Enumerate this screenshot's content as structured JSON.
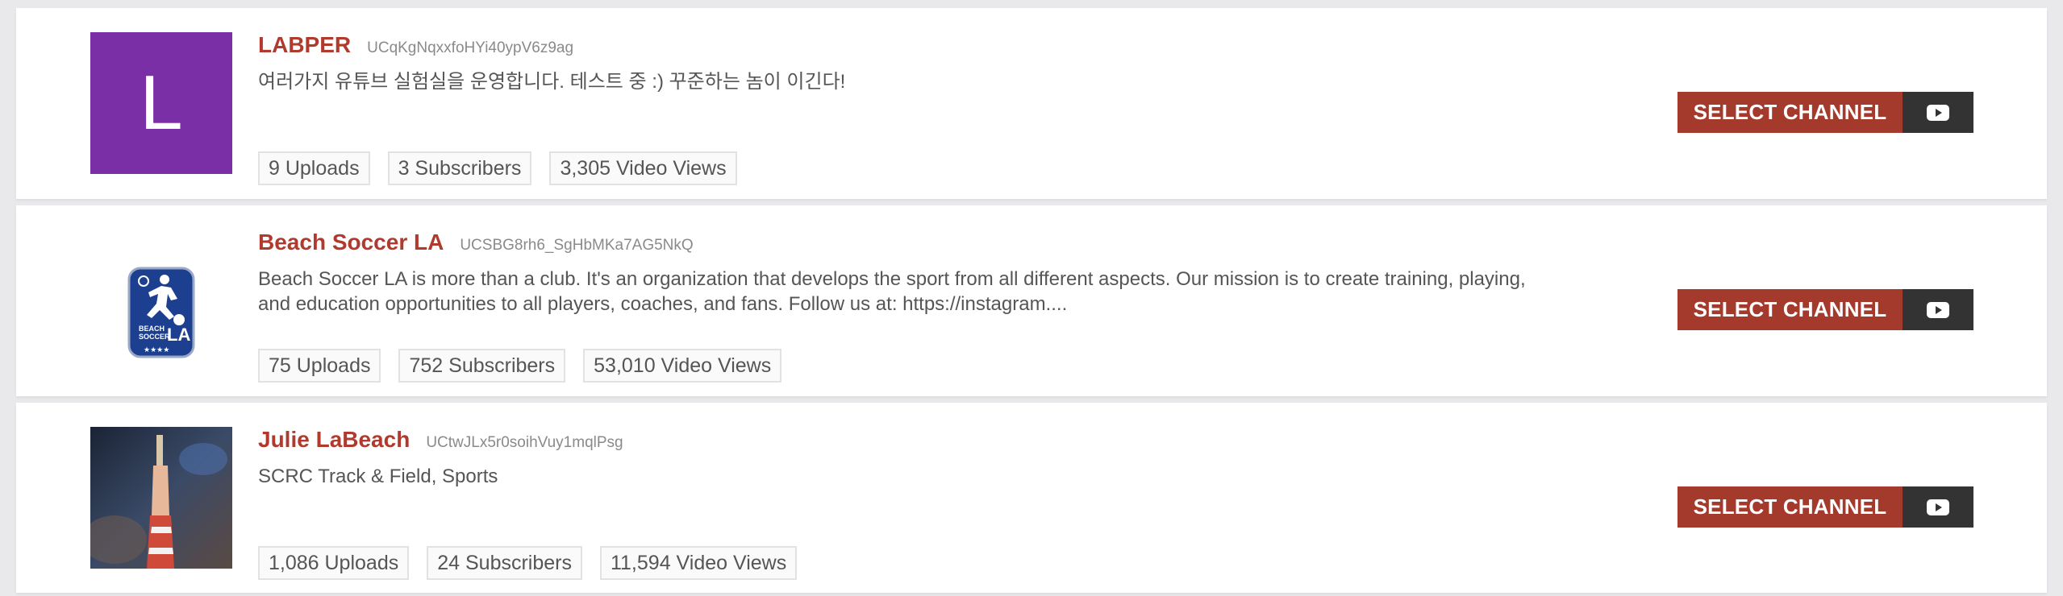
{
  "channels": [
    {
      "name": "LABPER",
      "id": "UCqKgNqxxfoHYi40ypV6z9ag",
      "description": "여러가지 유튜브 실험실을 운영합니다. 테스트 중 :) 꾸준하는 놈이 이긴다!",
      "avatar_letter": "L",
      "avatar_color": "#7b2fa6",
      "uploads": "9 Uploads",
      "subscribers": "3 Subscribers",
      "views": "3,305 Video Views",
      "button_label": "SELECT CHANNEL"
    },
    {
      "name": "Beach Soccer LA",
      "id": "UCSBG8rh6_SgHbMKa7AG5NkQ",
      "description": "Beach Soccer LA is more than a club. It's an organization that develops the sport from all different aspects. Our mission is to create training, playing, and education opportunities to all players, coaches, and fans. Follow us at: https://instagram....",
      "uploads": "75 Uploads",
      "subscribers": "752 Subscribers",
      "views": "53,010 Video Views",
      "button_label": "SELECT CHANNEL",
      "avatar_logo": {
        "line1": "BEACH",
        "line2": "SOCCER",
        "line3": "LA",
        "color": "#1c3f8f"
      }
    },
    {
      "name": "Julie LaBeach",
      "id": "UCtwJLx5r0soihVuy1mqlPsg",
      "description": "SCRC Track & Field, Sports",
      "uploads": "1,086 Uploads",
      "subscribers": "24 Subscribers",
      "views": "11,594 Video Views",
      "button_label": "SELECT CHANNEL"
    }
  ],
  "colors": {
    "accent": "#b03a2e",
    "button": "#a33a2c",
    "button_icon_bg": "#333333",
    "background": "#e9e9ec"
  },
  "icons": {
    "button_icon": "youtube-play-icon"
  }
}
